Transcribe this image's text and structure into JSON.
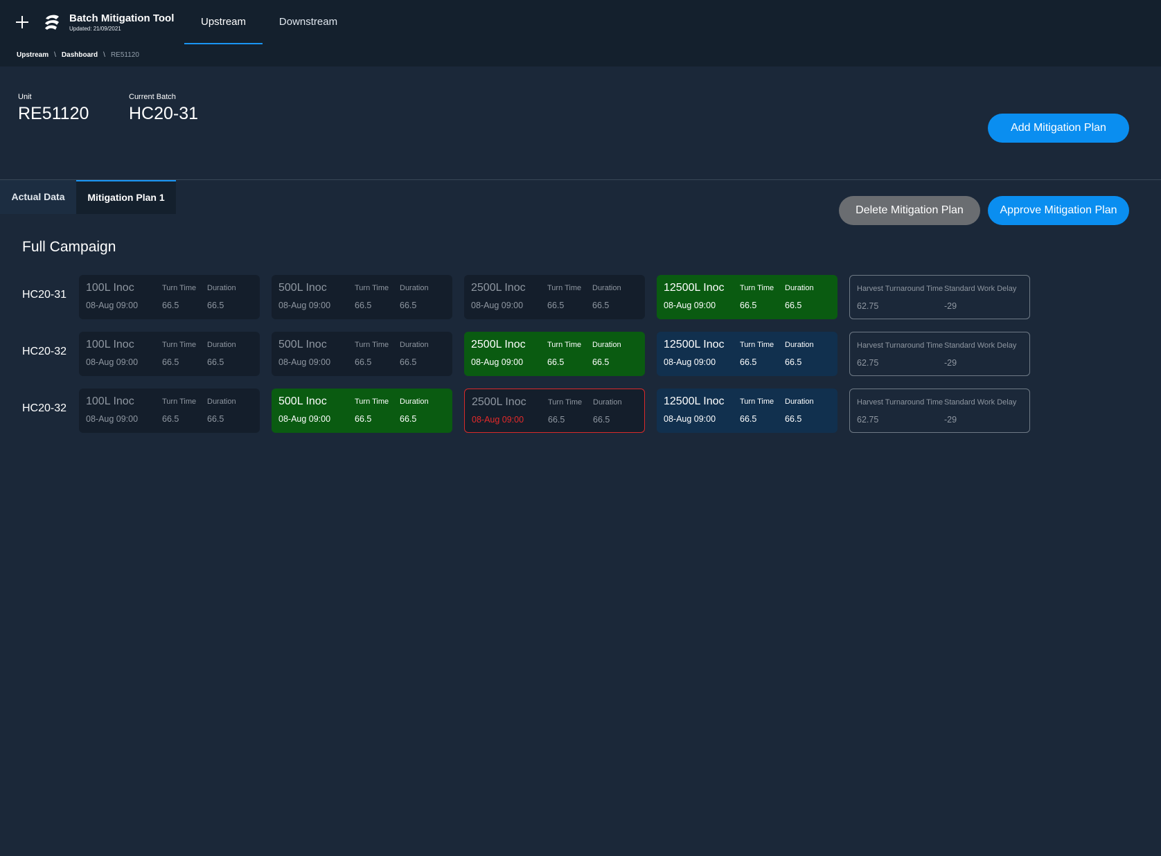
{
  "app": {
    "title": "Batch Mitigation Tool",
    "updated": "Updated: 21/09/2021"
  },
  "nav": {
    "tabs": [
      "Upstream",
      "Downstream"
    ],
    "active": "Upstream"
  },
  "breadcrumb": {
    "items": [
      "Upstream",
      "Dashboard",
      "RE51120"
    ],
    "separator": "\\"
  },
  "header": {
    "unit_label": "Unit",
    "unit_value": "RE51120",
    "batch_label": "Current Batch",
    "batch_value": "HC20-31",
    "add_button": "Add Mitigation Plan"
  },
  "tabs": {
    "items": [
      "Actual Data",
      "Mitigation Plan 1"
    ],
    "active": "Mitigation Plan 1"
  },
  "actions": {
    "delete": "Delete Mitigation Plan",
    "approve": "Approve Mitigation Plan"
  },
  "section": {
    "title": "Full Campaign"
  },
  "labels": {
    "turn_time": "Turn Time",
    "duration": "Duration",
    "harvest": "Harvest Turnaround Time",
    "delay": "Standard Work Delay"
  },
  "colors": {
    "green": "#0a5b11",
    "blue": "#11304e",
    "alert": "#e52a2a",
    "accent": "#0a8ef0"
  },
  "rows": [
    {
      "batch": "HC20-31",
      "stages": [
        {
          "name": "100L Inoc",
          "date": "08-Aug 09:00",
          "turn_time": "66.5",
          "duration": "66.5",
          "state": "default"
        },
        {
          "name": "500L Inoc",
          "date": "08-Aug 09:00",
          "turn_time": "66.5",
          "duration": "66.5",
          "state": "default"
        },
        {
          "name": "2500L Inoc",
          "date": "08-Aug 09:00",
          "turn_time": "66.5",
          "duration": "66.5",
          "state": "default"
        },
        {
          "name": "12500L Inoc",
          "date": "08-Aug 09:00",
          "turn_time": "66.5",
          "duration": "66.5",
          "state": "green"
        }
      ],
      "harvest": "62.75",
      "delay": "-29"
    },
    {
      "batch": "HC20-32",
      "stages": [
        {
          "name": "100L Inoc",
          "date": "08-Aug 09:00",
          "turn_time": "66.5",
          "duration": "66.5",
          "state": "default"
        },
        {
          "name": "500L Inoc",
          "date": "08-Aug 09:00",
          "turn_time": "66.5",
          "duration": "66.5",
          "state": "default"
        },
        {
          "name": "2500L Inoc",
          "date": "08-Aug 09:00",
          "turn_time": "66.5",
          "duration": "66.5",
          "state": "green"
        },
        {
          "name": "12500L Inoc",
          "date": "08-Aug 09:00",
          "turn_time": "66.5",
          "duration": "66.5",
          "state": "blue"
        }
      ],
      "harvest": "62.75",
      "delay": "-29"
    },
    {
      "batch": "HC20-32",
      "stages": [
        {
          "name": "100L Inoc",
          "date": "08-Aug 09:00",
          "turn_time": "66.5",
          "duration": "66.5",
          "state": "default"
        },
        {
          "name": "500L Inoc",
          "date": "08-Aug 09:00",
          "turn_time": "66.5",
          "duration": "66.5",
          "state": "green"
        },
        {
          "name": "2500L Inoc",
          "date": "08-Aug 09:00",
          "turn_time": "66.5",
          "duration": "66.5",
          "state": "alert"
        },
        {
          "name": "12500L Inoc",
          "date": "08-Aug 09:00",
          "turn_time": "66.5",
          "duration": "66.5",
          "state": "blue"
        }
      ],
      "harvest": "62.75",
      "delay": "-29"
    }
  ]
}
